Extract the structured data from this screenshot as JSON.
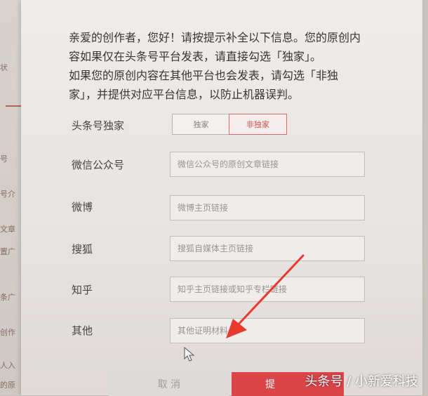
{
  "background_page": {
    "fragments": [
      "状",
      "号",
      "号介",
      "文章",
      "置广",
      "条广",
      "创作",
      "人入",
      "的原"
    ]
  },
  "intro": {
    "line1": "亲爱的创作者，您好！请按提示补全以下信息。您的原创内",
    "line2": "容如果仅在头条号平台发表，请直接勾选「独家」。",
    "line3": "如果您的原创内容在其他平台也会发表，请勾选「非独",
    "line4": "家」，并提供对应平台信息，以防止机器误判。"
  },
  "form": {
    "exclusive_label": "头条号独家",
    "exclusive_option": "独家",
    "non_exclusive_option": "非独家",
    "wechat_label": "微信公众号",
    "wechat_placeholder": "微信公众号的原创文章链接",
    "weibo_label": "微博",
    "weibo_placeholder": "微博主页链接",
    "sohu_label": "搜狐",
    "sohu_placeholder": "搜狐自媒体主页链接",
    "zhihu_label": "知乎",
    "zhihu_placeholder": "知乎主页链接或知乎专栏链接",
    "other_label": "其他",
    "other_placeholder": "其他证明材料"
  },
  "actions": {
    "cancel_label": "取 消",
    "submit_label": "提"
  },
  "watermark": "头条号 / 小新爱科技",
  "colors": {
    "accent": "#dc4548",
    "annotation_arrow": "#e8392f"
  }
}
